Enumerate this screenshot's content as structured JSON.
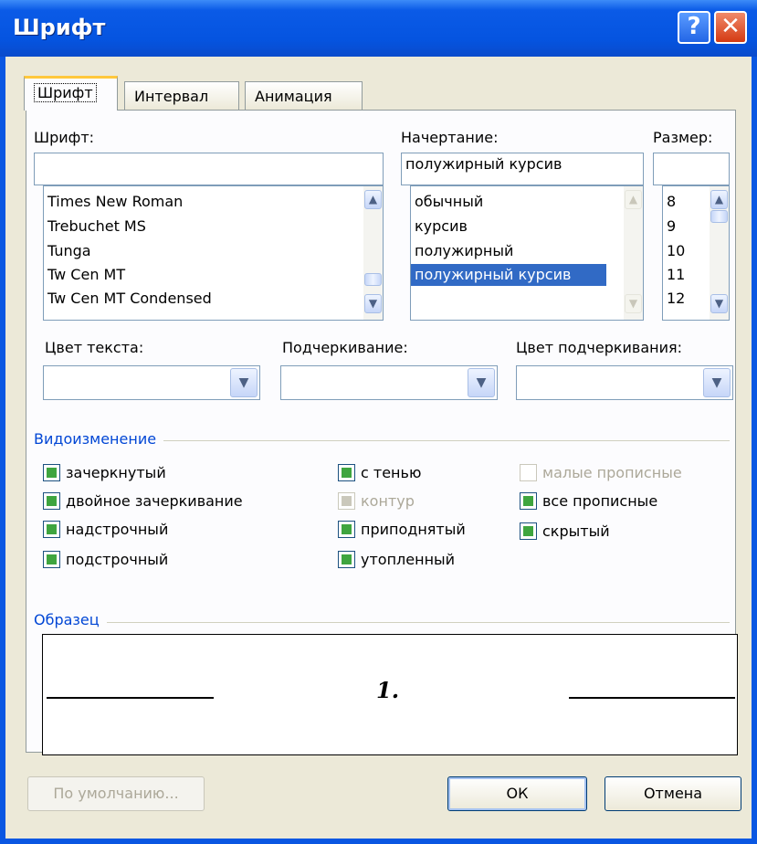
{
  "window": {
    "title": "Шрифт",
    "help_label": "?",
    "close_label": "✕"
  },
  "tabs": [
    {
      "label": "Шрифт"
    },
    {
      "label": "Интервал"
    },
    {
      "label": "Анимация"
    }
  ],
  "font": {
    "label": "Шрифт:",
    "value": "",
    "items": [
      "Times New Roman",
      "Trebuchet MS",
      "Tunga",
      "Tw Cen MT",
      "Tw Cen MT Condensed"
    ]
  },
  "style": {
    "label": "Начертание:",
    "value": "полужирный курсив",
    "items": [
      "обычный",
      "курсив",
      "полужирный",
      "полужирный курсив"
    ],
    "selected": "полужирный курсив"
  },
  "size": {
    "label": "Размер:",
    "value": "",
    "items": [
      "8",
      "9",
      "10",
      "11",
      "12"
    ]
  },
  "text_color": {
    "label": "Цвет текста:",
    "value": ""
  },
  "underline": {
    "label": "Подчеркивание:",
    "value": ""
  },
  "underline_color": {
    "label": "Цвет подчеркивания:",
    "value": ""
  },
  "effects": {
    "label": "Видоизменение",
    "items": [
      {
        "label": "зачеркнутый",
        "state": "mixed"
      },
      {
        "label": "двойное зачеркивание",
        "state": "mixed"
      },
      {
        "label": "надстрочный",
        "state": "mixed"
      },
      {
        "label": "подстрочный",
        "state": "mixed"
      },
      {
        "label": "с тенью",
        "state": "mixed"
      },
      {
        "label": "контур",
        "state": "disabled"
      },
      {
        "label": "приподнятый",
        "state": "mixed"
      },
      {
        "label": "утопленный",
        "state": "mixed"
      },
      {
        "label": "малые прописные",
        "state": "disabled"
      },
      {
        "label": "все прописные",
        "state": "mixed"
      },
      {
        "label": "скрытый",
        "state": "mixed"
      }
    ]
  },
  "preview": {
    "label": "Образец",
    "text": "1."
  },
  "buttons": {
    "default_label": "По умолчанию...",
    "ok_label": "ОК",
    "cancel_label": "Отмена"
  },
  "colors": {
    "titlebar": "#0554e0",
    "selection": "#316ac5",
    "group_label": "#0046d5",
    "check_fill": "#3fa53f"
  }
}
